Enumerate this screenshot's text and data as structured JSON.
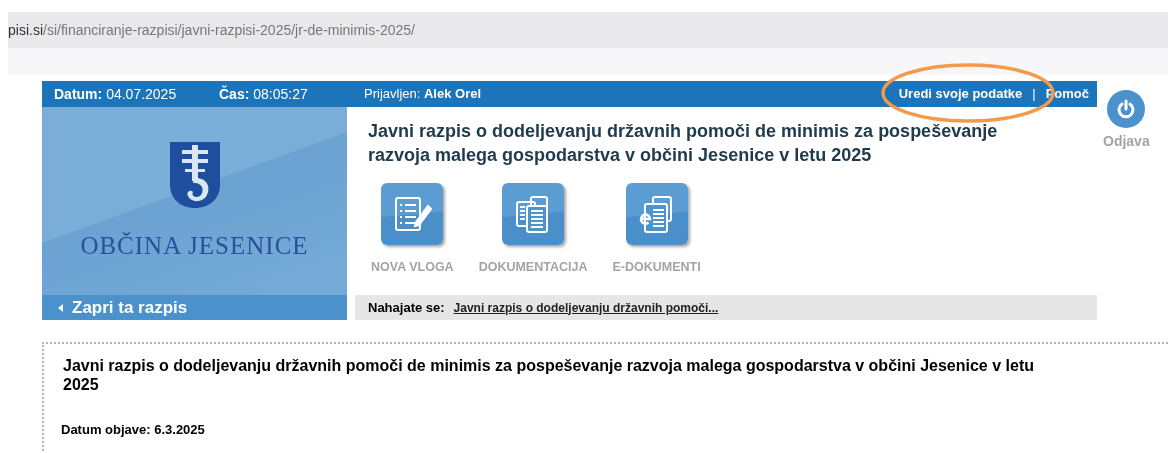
{
  "address_bar": {
    "host": "pisi.si",
    "path": "/si/financiranje-razpisi/javni-razpisi-2025/jr-de-minimis-2025/"
  },
  "top_bar": {
    "date_label": "Datum:",
    "date": "04.07.2025",
    "time_label": "Čas:",
    "time": "08:05:27",
    "user_label": "Prijavljen:",
    "user": "Alek Orel",
    "links": [
      "Uredi svoje podatke",
      "Pomoč"
    ],
    "separator": "|"
  },
  "logo": {
    "name": "OBČINA JESENICE"
  },
  "title": "Javni razpis o dodeljevanju državnih pomoči de minimis za pospeševanje razvoja malega gospodarstva v občini Jesenice v letu 2025",
  "actions": [
    {
      "kind": "form",
      "label": "NOVA VLOGA"
    },
    {
      "kind": "documents",
      "label": "DOKUMENTACIJA"
    },
    {
      "kind": "e-documents",
      "label": "E-DOKUMENTI"
    }
  ],
  "back_link": {
    "label": "Zapri ta razpis"
  },
  "breadcrumb": {
    "label": "Nahajate se:",
    "current": "Javni razpis o dodeljevanju državnih pomoči..."
  },
  "logout": {
    "label": "Odjava"
  },
  "content": {
    "title": "Javni razpis o dodeljevanju državnih pomoči de minimis za pospeševanje razvoja malega gospodarstva v občini Jesenice v letu 2025",
    "published_label": "Datum objave:",
    "published": "6.3.2025"
  }
}
